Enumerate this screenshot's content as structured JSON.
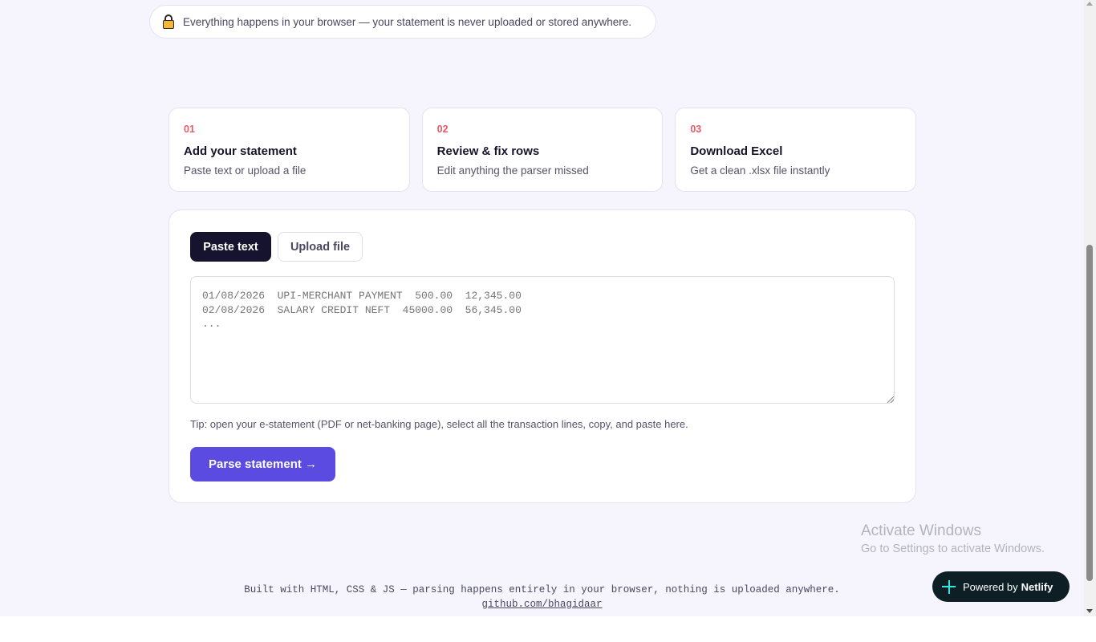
{
  "privacy_notice": {
    "icon": "lock-icon",
    "text": "Everything happens in your browser — your statement is never uploaded or stored anywhere."
  },
  "steps": [
    {
      "number": "01",
      "title": "Add your statement",
      "description": "Paste text or upload a file"
    },
    {
      "number": "02",
      "title": "Review & fix rows",
      "description": "Edit anything the parser missed"
    },
    {
      "number": "03",
      "title": "Download Excel",
      "description": "Get a clean .xlsx file instantly"
    }
  ],
  "input_panel": {
    "tabs": [
      {
        "label": "Paste text",
        "active": true
      },
      {
        "label": "Upload file",
        "active": false
      }
    ],
    "placeholder": "01/08/2026  UPI-MERCHANT PAYMENT  500.00  12,345.00\n02/08/2026  SALARY CREDIT NEFT  45000.00  56,345.00\n...",
    "tip": "Tip: open your e-statement (PDF or net-banking page), select all the transaction lines, copy, and paste here.",
    "parse_button": "Parse statement →"
  },
  "watermark": {
    "line1": "Activate Windows",
    "line2": "Go to Settings to activate Windows."
  },
  "footer": {
    "text": "Built with HTML, CSS & JS — parsing happens entirely in your browser, nothing is uploaded anywhere.",
    "link": "github.com/bhagidaar"
  },
  "netlify_badge": {
    "prefix": "Powered by",
    "brand": "Netlify"
  },
  "colors": {
    "accent": "#5b4be0",
    "step_number": "#e85a64",
    "tab_active": "#16132e",
    "page_background": "#f6f5fe"
  }
}
